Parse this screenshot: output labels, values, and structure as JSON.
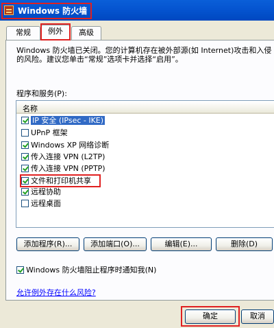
{
  "window": {
    "title": "Windows 防火墙"
  },
  "tabs": [
    {
      "label": "常规"
    },
    {
      "label": "例外"
    },
    {
      "label": "高级"
    }
  ],
  "description": "Windows 防火墙已关闭。您的计算机存在被外部源(如 Internet)攻击和入侵的风险。建议您单击“常规”选项卡并选择“启用”。",
  "programs_label": "程序和服务(P):",
  "list": {
    "column_header": "名称",
    "items": [
      {
        "label": "IP 安全 (IPsec - IKE)",
        "checked": true,
        "selected": true
      },
      {
        "label": "UPnP 框架",
        "checked": false,
        "selected": false
      },
      {
        "label": "Windows XP 网络诊断",
        "checked": true,
        "selected": false
      },
      {
        "label": "传入连接 VPN (L2TP)",
        "checked": true,
        "selected": false
      },
      {
        "label": "传入连接 VPN (PPTP)",
        "checked": true,
        "selected": false
      },
      {
        "label": "文件和打印机共享",
        "checked": true,
        "selected": false
      },
      {
        "label": "远程协助",
        "checked": true,
        "selected": false
      },
      {
        "label": "远程桌面",
        "checked": false,
        "selected": false
      }
    ]
  },
  "buttons": {
    "add_program": "添加程序(R)...",
    "add_port": "添加端口(O)...",
    "edit": "编辑(E)...",
    "delete": "删除(D)"
  },
  "notify": {
    "label": "Windows 防火墙阻止程序时通知我(N)",
    "checked": true
  },
  "risk_link": "允许例外存在什么风险?",
  "footer": {
    "ok": "确定",
    "cancel": "取消"
  },
  "colors": {
    "title_bar": "#0554d0",
    "highlight_box": "#e02020",
    "selection": "#316ac5",
    "link": "#0000ff"
  }
}
